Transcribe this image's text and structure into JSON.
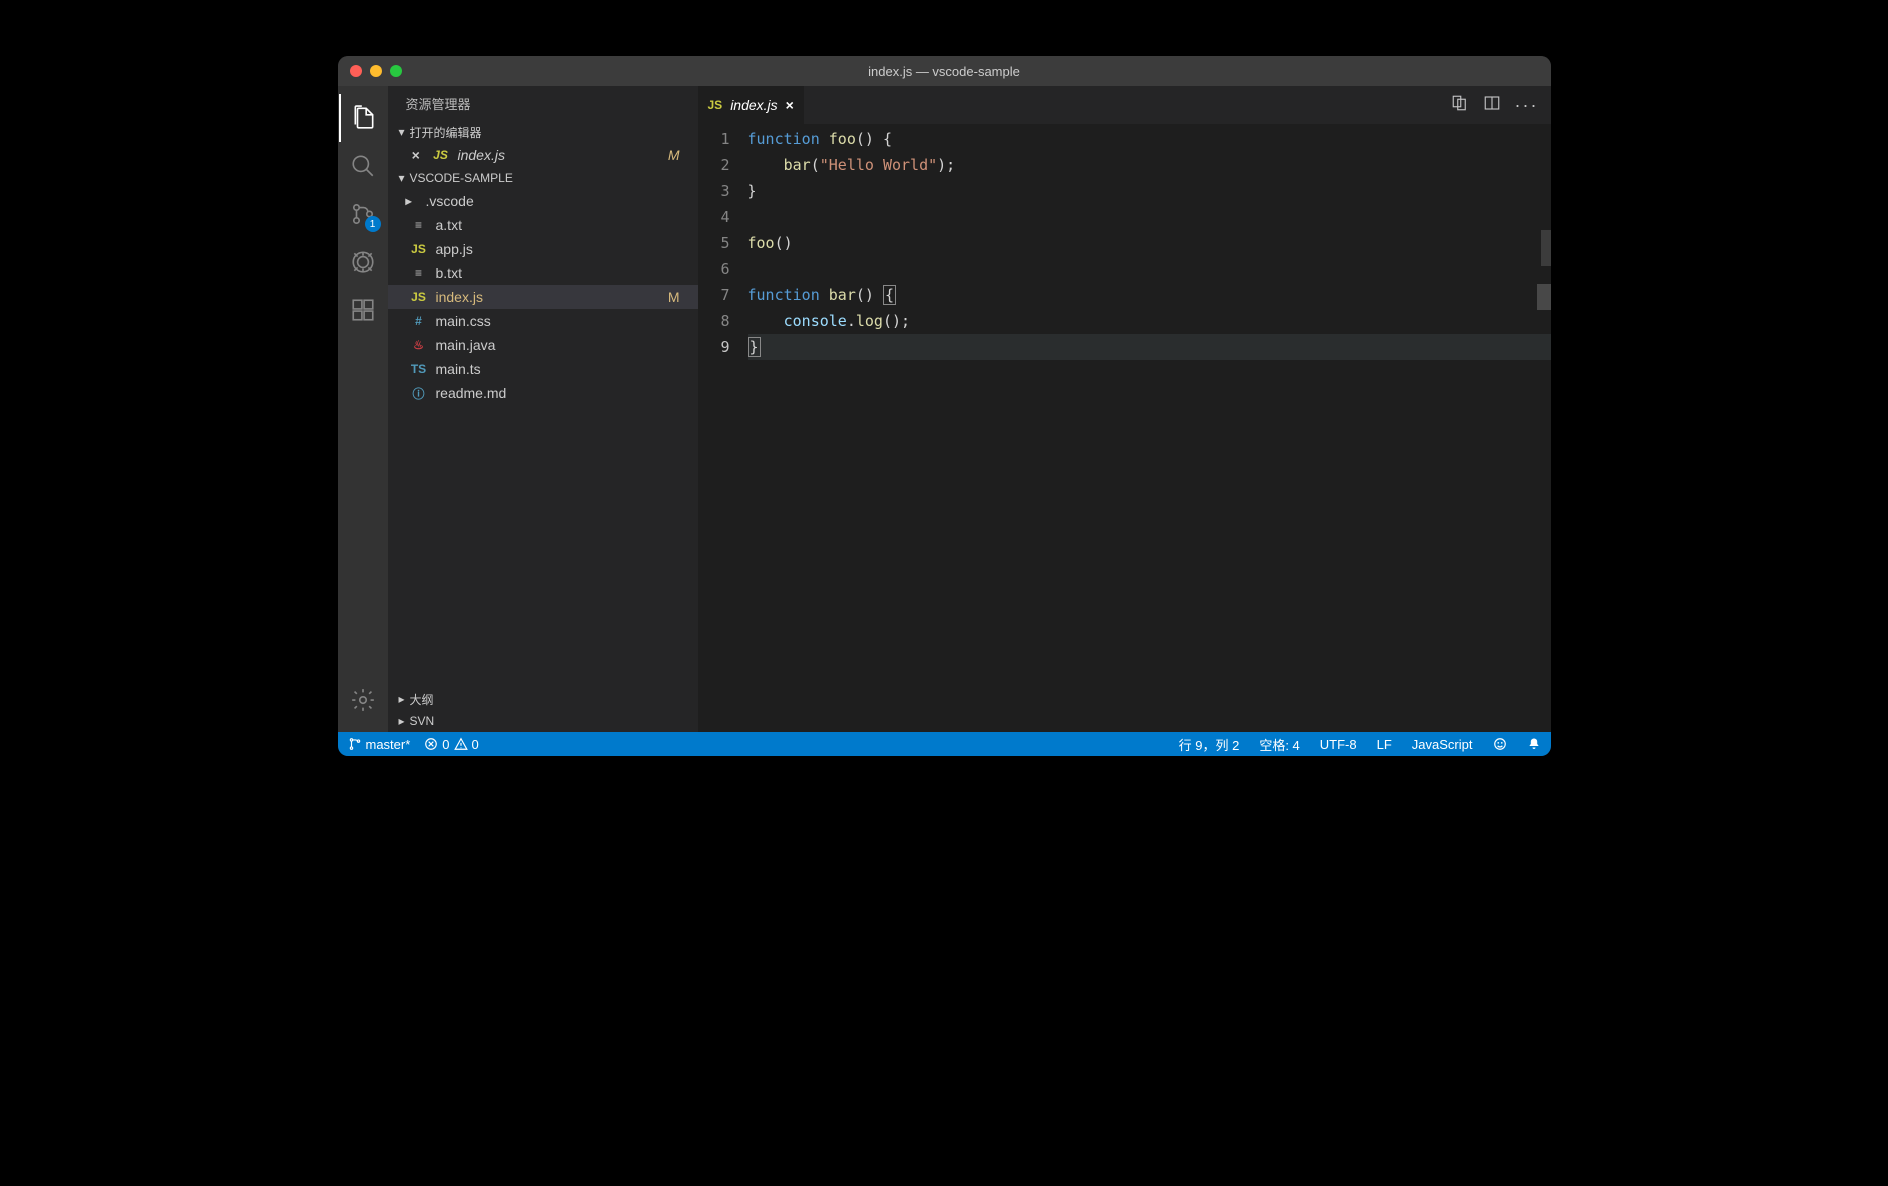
{
  "titlebar": {
    "title": "index.js — vscode-sample"
  },
  "activitybar": {
    "scm_badge": "1"
  },
  "sidebar": {
    "title": "资源管理器",
    "open_editors_header": "打开的编辑器",
    "open_editor_file": "index.js",
    "open_editor_git": "M",
    "workspace_name": "VSCODE-SAMPLE",
    "files": [
      {
        "name": ".vscode",
        "icon": "folder",
        "kind": "folder"
      },
      {
        "name": "a.txt",
        "icon": "txt",
        "kind": "file"
      },
      {
        "name": "app.js",
        "icon": "js",
        "kind": "file"
      },
      {
        "name": "b.txt",
        "icon": "txt",
        "kind": "file"
      },
      {
        "name": "index.js",
        "icon": "js",
        "kind": "file",
        "selected": true,
        "git": "M"
      },
      {
        "name": "main.css",
        "icon": "css",
        "kind": "file"
      },
      {
        "name": "main.java",
        "icon": "java",
        "kind": "file"
      },
      {
        "name": "main.ts",
        "icon": "ts",
        "kind": "file"
      },
      {
        "name": "readme.md",
        "icon": "info",
        "kind": "file"
      }
    ],
    "outline_header": "大纲",
    "svn_header": "SVN"
  },
  "editor": {
    "tab_label": "index.js",
    "line_numbers": [
      "1",
      "2",
      "3",
      "4",
      "5",
      "6",
      "7",
      "8",
      "9"
    ],
    "cursor_line": 9,
    "code_lines": [
      {
        "html": "<span class='tok-kw'>function</span> <span class='tok-fn'>foo</span>() {"
      },
      {
        "html": "    <span class='tok-fn'>bar</span>(<span class='tok-str'>\"Hello World\"</span>);"
      },
      {
        "html": "}"
      },
      {
        "html": ""
      },
      {
        "html": "<span class='tok-fn'>foo</span>()"
      },
      {
        "html": ""
      },
      {
        "html": "<span class='tok-kw'>function</span> <span class='tok-fn'>bar</span>() <span class='brace-box'>{</span>"
      },
      {
        "html": "    <span class='tok-obj'>console</span>.<span class='tok-fn'>log</span>();"
      },
      {
        "html": "<span class='brace-box'>}</span>",
        "cursor": true
      }
    ]
  },
  "statusbar": {
    "branch": "master*",
    "errors": "0",
    "warnings": "0",
    "cursor": "行 9，列 2",
    "spaces": "空格: 4",
    "encoding": "UTF-8",
    "eol": "LF",
    "language": "JavaScript"
  }
}
